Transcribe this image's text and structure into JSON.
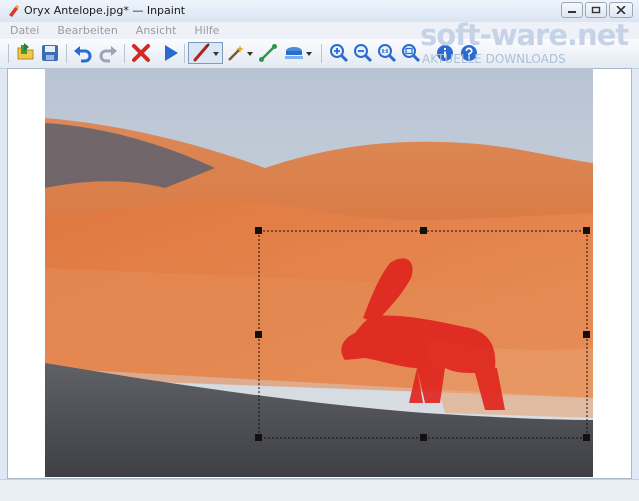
{
  "window": {
    "title": "Oryx Antelope.jpg* — Inpaint"
  },
  "menu": {
    "items": [
      "Datei",
      "Bearbeiten",
      "Ansicht",
      "Hilfe"
    ]
  },
  "toolbar": {
    "open": "open-folder-icon",
    "save": "save-icon",
    "undo": "undo-icon",
    "redo": "redo-icon",
    "erase": "delete-icon",
    "run": "play-icon",
    "marker": "marker-icon",
    "magic_wand": "magic-wand-icon",
    "line": "line-tool-icon",
    "stamp": "stamp-icon",
    "zoom_in": "zoom-in-icon",
    "zoom_out": "zoom-out-icon",
    "zoom_reset": "zoom-actual-icon",
    "zoom_fit": "zoom-fit-icon",
    "info": "info-icon",
    "help": "help-icon"
  },
  "watermark": {
    "brand": "soft-ware.net",
    "tagline": "AKTUELLE DOWNLOADS"
  },
  "colors": {
    "selection_mask": "#e0241e",
    "accent": "#2a6bd1"
  },
  "status": {
    "text": ""
  }
}
